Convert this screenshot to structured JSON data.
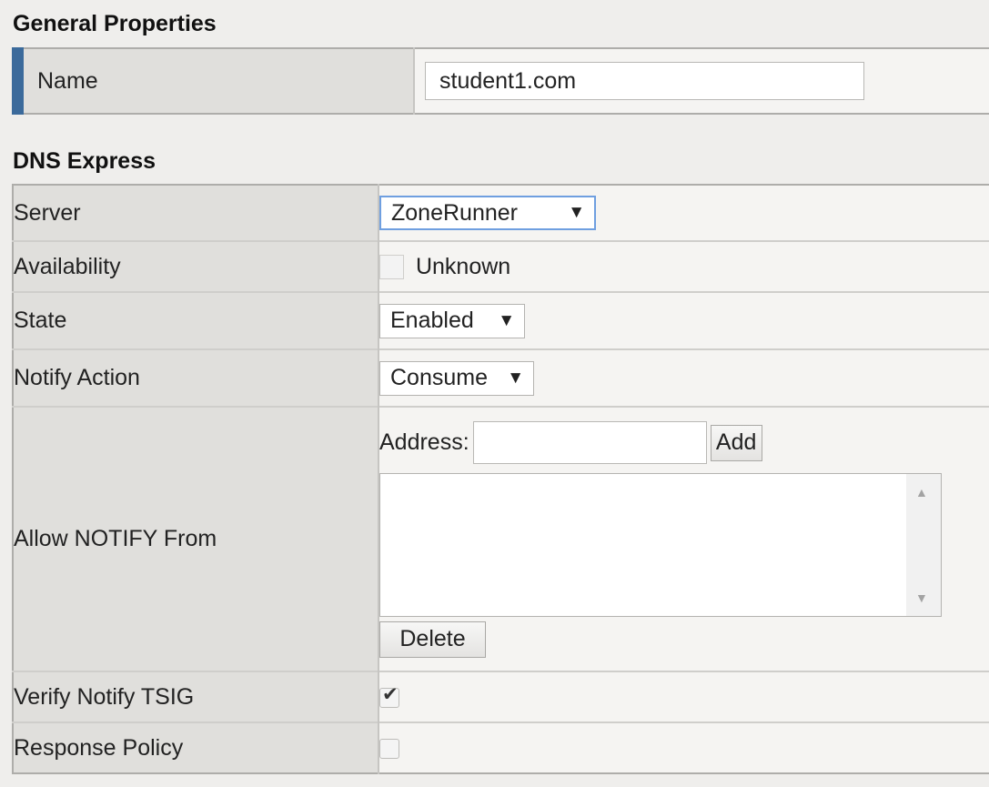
{
  "general": {
    "title": "General Properties",
    "name_label": "Name",
    "name_value": "student1.com"
  },
  "dns": {
    "title": "DNS Express",
    "server_label": "Server",
    "server_value": "ZoneRunner",
    "availability_label": "Availability",
    "availability_value": "Unknown",
    "state_label": "State",
    "state_value": "Enabled",
    "notify_action_label": "Notify Action",
    "notify_action_value": "Consume",
    "allow_notify_label": "Allow NOTIFY From",
    "address_label": "Address:",
    "address_value": "",
    "add_label": "Add",
    "delete_label": "Delete",
    "verify_tsig_label": "Verify Notify TSIG",
    "verify_tsig_checked": true,
    "response_policy_label": "Response Policy",
    "response_policy_checked": false
  },
  "icons": {
    "caret": "triangle-down",
    "check": "check-mark",
    "scroll_up": "triangle-up",
    "scroll_down": "triangle-down"
  },
  "colors": {
    "accent_bar": "#3b6a9b",
    "label_bg": "#e0dfdc",
    "value_bg": "#f5f4f2",
    "focus_border": "#6f9fe0"
  }
}
